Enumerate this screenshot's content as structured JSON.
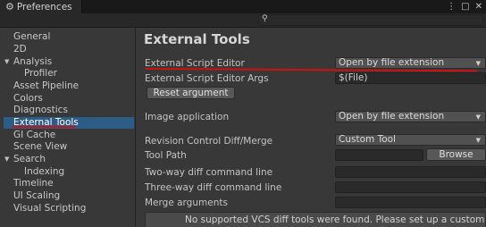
{
  "window": {
    "title": "Preferences",
    "controls": [
      "⋮",
      "□",
      "✕"
    ]
  },
  "search": {
    "value": ""
  },
  "sidebar": {
    "items": [
      {
        "label": "General"
      },
      {
        "label": "2D"
      },
      {
        "label": "Analysis",
        "expanded": true
      },
      {
        "label": "Profiler"
      },
      {
        "label": "Asset Pipeline"
      },
      {
        "label": "Colors"
      },
      {
        "label": "Diagnostics"
      },
      {
        "label": "External Tools",
        "selected": true
      },
      {
        "label": "GI Cache"
      },
      {
        "label": "Scene View"
      },
      {
        "label": "Search",
        "expanded": true
      },
      {
        "label": "Indexing"
      },
      {
        "label": "Timeline"
      },
      {
        "label": "UI Scaling"
      },
      {
        "label": "Visual Scripting"
      }
    ]
  },
  "main": {
    "heading": "External Tools",
    "script_editor": {
      "label": "External Script Editor",
      "value": "Open by file extension"
    },
    "script_editor_args": {
      "label": "External Script Editor Args",
      "value": "$(File)"
    },
    "reset_button": "Reset argument",
    "image_app": {
      "label": "Image application",
      "value": "Open by file extension"
    },
    "revision_control": {
      "label": "Revision Control Diff/Merge",
      "value": "Custom Tool"
    },
    "tool_path": {
      "label": "Tool Path",
      "value": "",
      "browse": "Browse"
    },
    "two_way": {
      "label": "Two-way diff command line",
      "value": ""
    },
    "three_way": {
      "label": "Three-way diff command line",
      "value": ""
    },
    "merge_args": {
      "label": "Merge arguments",
      "value": ""
    },
    "help_text": "No supported VCS diff tools were found. Please set up a custom tool"
  },
  "colors": {
    "selection": "#2c5d87",
    "annotation_red": "#d01010",
    "background": "#383838"
  },
  "icons": {
    "tab": "gear-icon",
    "search": "magnifier-icon",
    "dropdown": "triangle-down-icon",
    "foldout": "triangle-down-icon"
  }
}
